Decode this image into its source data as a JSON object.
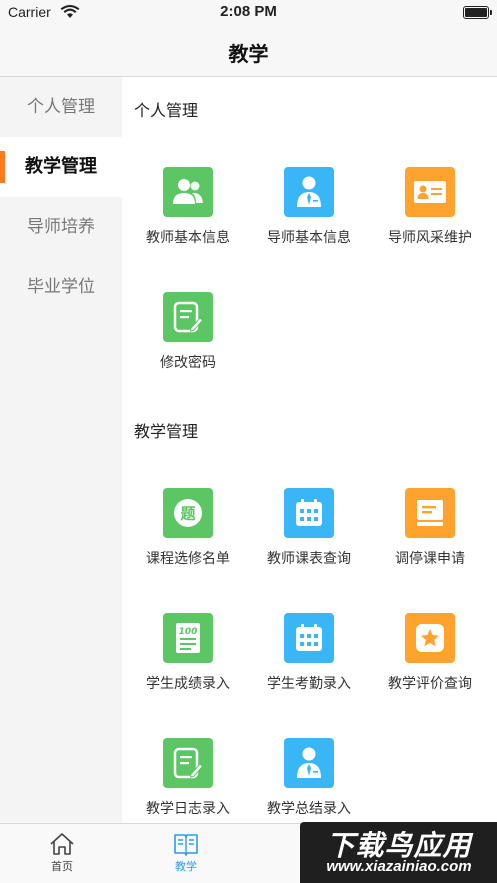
{
  "status": {
    "carrier": "Carrier",
    "time": "2:08 PM"
  },
  "nav": {
    "title": "教学"
  },
  "sidebar": {
    "items": [
      {
        "label": "个人管理",
        "active": false
      },
      {
        "label": "教学管理",
        "active": true
      },
      {
        "label": "导师培养",
        "active": false
      },
      {
        "label": "毕业学位",
        "active": false
      }
    ]
  },
  "sections": [
    {
      "title": "个人管理",
      "items": [
        {
          "label": "教师基本信息",
          "icon": "users-icon",
          "color": "#5cc665"
        },
        {
          "label": "导师基本信息",
          "icon": "person-tie-icon",
          "color": "#39b6f5"
        },
        {
          "label": "导师风采维护",
          "icon": "id-card-icon",
          "color": "#ffa22e"
        },
        {
          "label": "修改密码",
          "icon": "edit-note-icon",
          "color": "#5cc665"
        }
      ]
    },
    {
      "title": "教学管理",
      "items": [
        {
          "label": "课程选修名单",
          "icon": "question-badge-icon",
          "badge": "题",
          "color": "#5cc665"
        },
        {
          "label": "教师课表查询",
          "icon": "calendar-icon",
          "color": "#39b6f5"
        },
        {
          "label": "调停课申请",
          "icon": "tablet-icon",
          "color": "#ffa22e"
        },
        {
          "label": "学生成绩录入",
          "icon": "score-sheet-icon",
          "badge": "100",
          "color": "#5cc665"
        },
        {
          "label": "学生考勤录入",
          "icon": "calendar-icon",
          "color": "#39b6f5"
        },
        {
          "label": "教学评价查询",
          "icon": "star-icon",
          "color": "#ffa22e"
        },
        {
          "label": "教学日志录入",
          "icon": "edit-note-icon",
          "color": "#5cc665"
        },
        {
          "label": "教学总结录入",
          "icon": "person-tie-icon",
          "color": "#39b6f5"
        }
      ]
    }
  ],
  "tabs": [
    {
      "label": "首页",
      "icon": "home-icon",
      "active": false
    },
    {
      "label": "教学",
      "icon": "book-icon",
      "active": true
    }
  ],
  "watermark": {
    "main": "下载鸟应用",
    "sub": "www.xiazainiao.com"
  },
  "colors": {
    "accent": "#ff7a1a",
    "tab_active": "#2a9ee8",
    "green": "#5cc665",
    "blue": "#39b6f5",
    "orange": "#ffa22e"
  }
}
